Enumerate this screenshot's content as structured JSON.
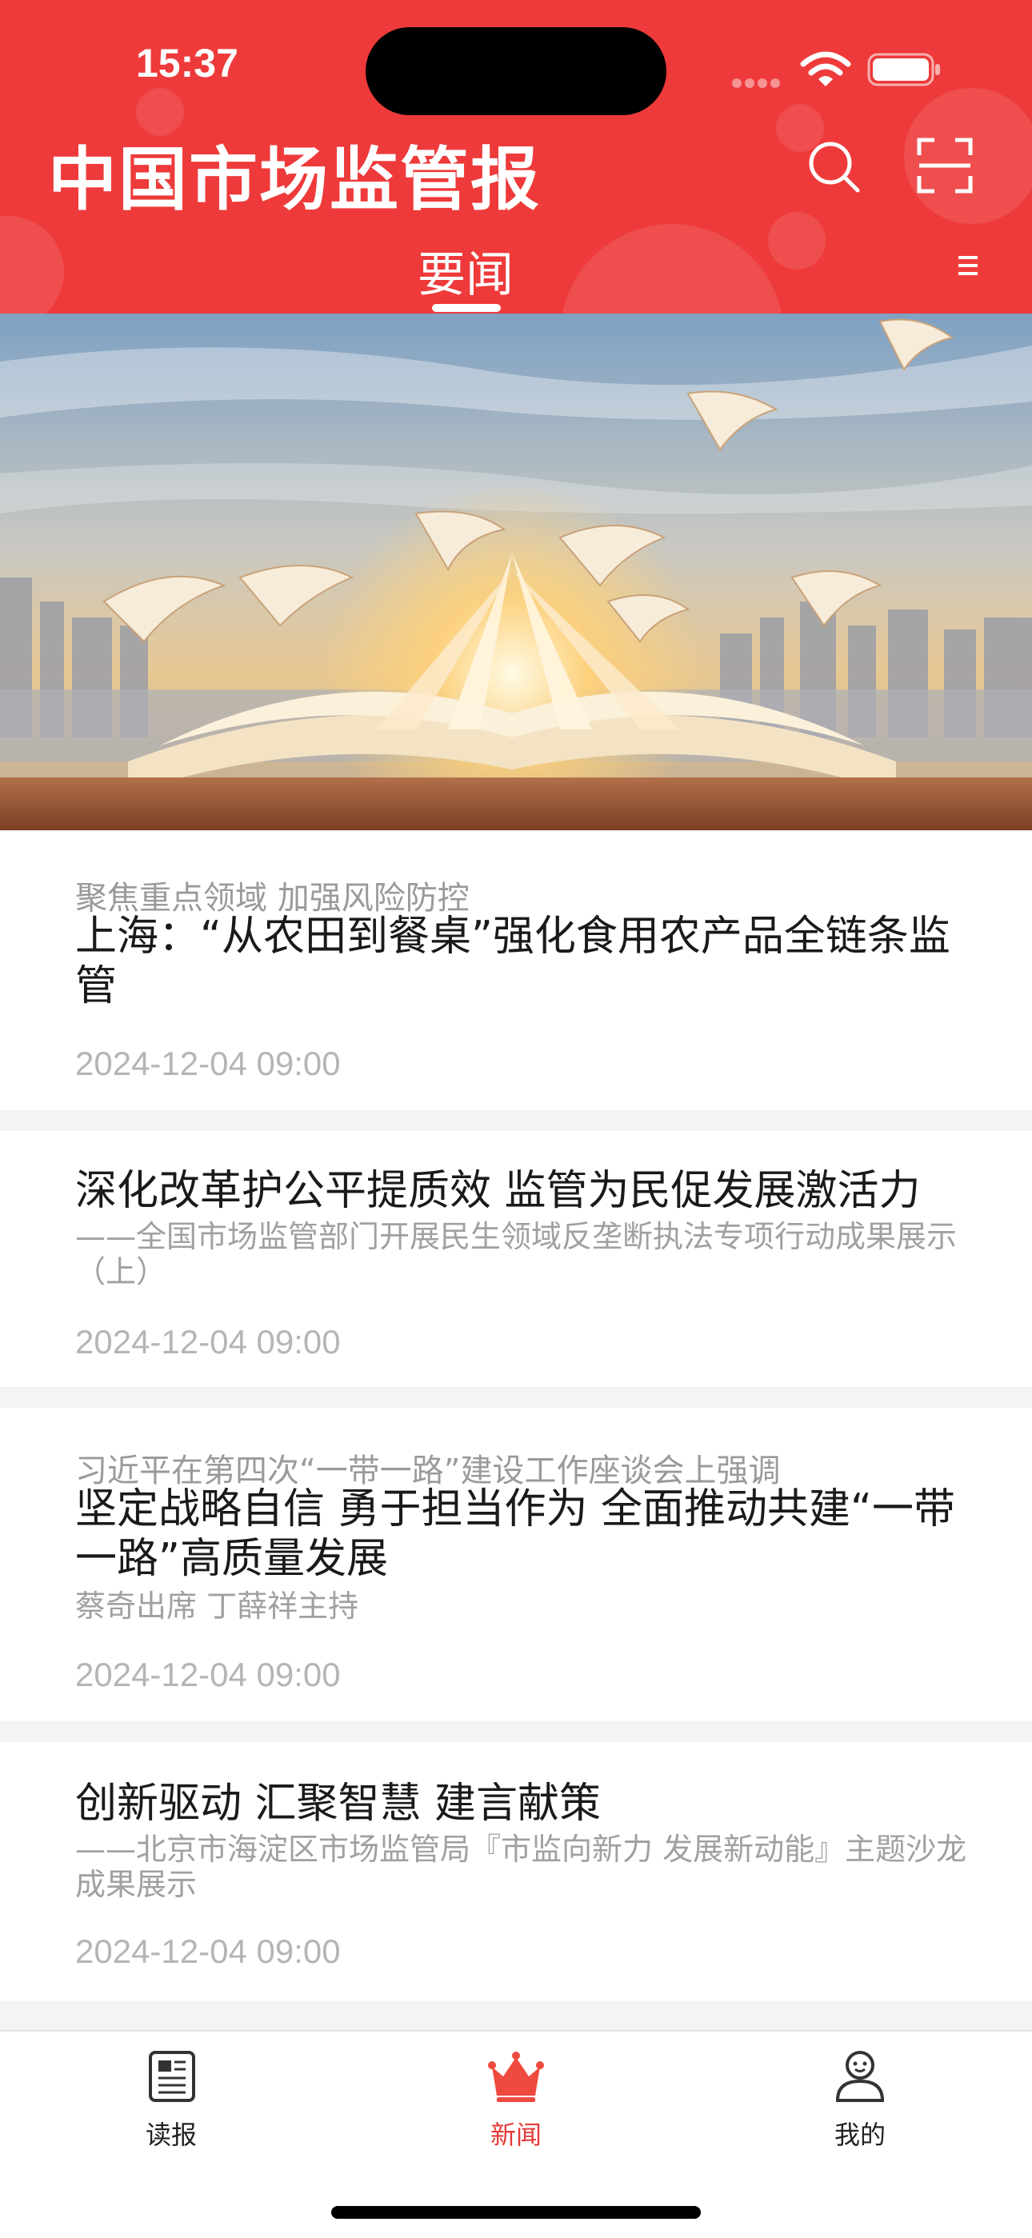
{
  "status_bar": {
    "time": "15:37"
  },
  "header": {
    "logo": "中国市场监管报",
    "active_tab": "要闻",
    "search_icon": "search-icon",
    "scan_icon": "scan-icon",
    "menu_icon": "menu-icon"
  },
  "colors": {
    "brand_red": "#ee3a3a",
    "active_tab_red": "#e53935",
    "timestamp_gray": "#b5b5b5"
  },
  "news": [
    {
      "kicker": "聚焦重点领域 加强风险防控",
      "headline": "上海：“从农田到餐桌”强化食用农产品全链条监管",
      "subline": "",
      "time": "2024-12-04 09:00"
    },
    {
      "kicker": "",
      "headline": "深化改革护公平提质效 监管为民促发展激活力",
      "subline": "——全国市场监管部门开展民生领域反垄断执法专项行动成果展示（上）",
      "time": "2024-12-04 09:00"
    },
    {
      "kicker": "习近平在第四次“一带一路”建设工作座谈会上强调",
      "headline": "坚定战略自信 勇于担当作为 全面推动共建“一带一路”高质量发展",
      "subline": "蔡奇出席 丁薛祥主持",
      "time": "2024-12-04 09:00"
    },
    {
      "kicker": "",
      "headline": "创新驱动 汇聚智慧 建言献策",
      "subline": "——北京市海淀区市场监管局『市监向新力 发展新动能』主题沙龙成果展示",
      "time": "2024-12-04 09:00"
    }
  ],
  "tabbar": {
    "items": [
      {
        "label": "读报",
        "icon": "newspaper-icon",
        "active": false
      },
      {
        "label": "新闻",
        "icon": "crown-icon",
        "active": true
      },
      {
        "label": "我的",
        "icon": "user-icon",
        "active": false
      }
    ]
  }
}
